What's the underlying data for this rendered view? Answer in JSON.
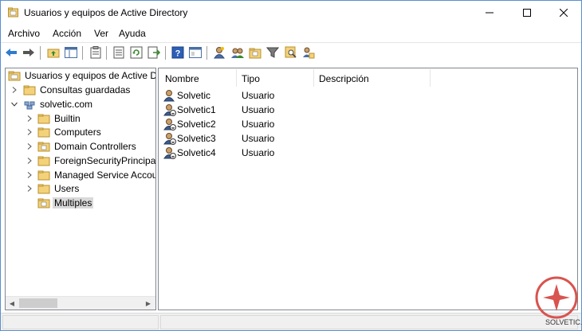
{
  "window": {
    "title": "Usuarios y equipos de Active Directory",
    "icon": "ad-folder-icon"
  },
  "menu": [
    "Archivo",
    "Acción",
    "Ver",
    "Ayuda"
  ],
  "toolbar": {
    "icons": [
      "back-arrow-icon",
      "forward-arrow-icon",
      "up-folder-icon",
      "show-hide-tree-icon",
      "clipboard-icon",
      "export-list-icon",
      "refresh-icon",
      "export-icon",
      "help-icon",
      "console-icon",
      "new-user-icon",
      "new-group-icon",
      "new-ou-icon",
      "filter-icon",
      "find-icon",
      "add-to-group-icon"
    ]
  },
  "tree": {
    "root": "Usuarios y equipos de Active Directory",
    "saved_queries": "Consultas guardadas",
    "domain": "solvetic.com",
    "children": [
      "Builtin",
      "Computers",
      "Domain Controllers",
      "ForeignSecurityPrincipals",
      "Managed Service Accounts",
      "Users",
      "Multiples"
    ],
    "selected": "Multiples"
  },
  "list": {
    "columns": [
      "Nombre",
      "Tipo",
      "Descripción"
    ],
    "rows": [
      {
        "name": "Solvetic",
        "type": "Usuario"
      },
      {
        "name": "Solvetic1",
        "type": "Usuario"
      },
      {
        "name": "Solvetic2",
        "type": "Usuario"
      },
      {
        "name": "Solvetic3",
        "type": "Usuario"
      },
      {
        "name": "Solvetic4",
        "type": "Usuario"
      }
    ]
  },
  "watermark": {
    "text": "SOLVETIC.COM",
    "color": "#d9534f"
  },
  "colors": {
    "accent": "#0078d7",
    "selection": "#d9d9d9",
    "window_border": "#5a8fd0"
  }
}
